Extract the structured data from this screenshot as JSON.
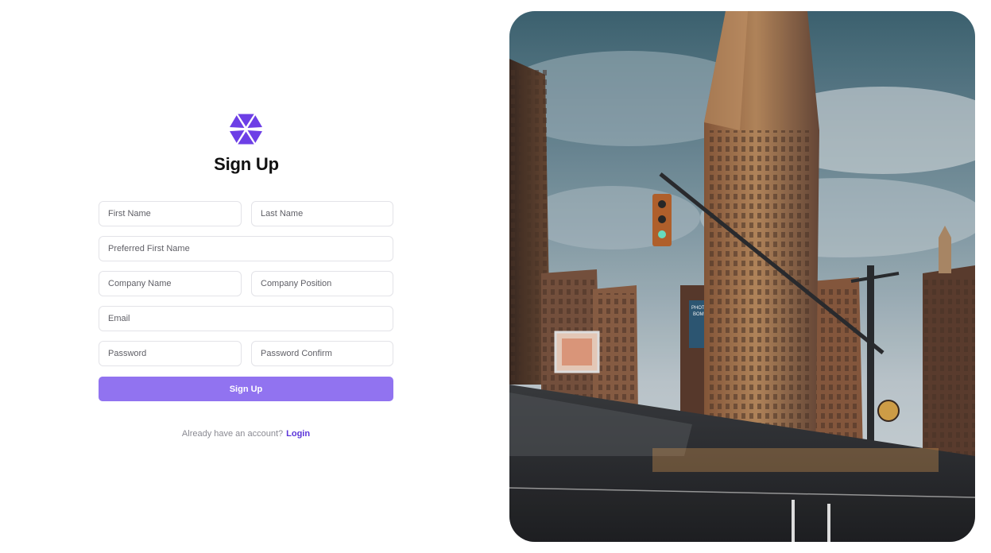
{
  "brand": {
    "logo_icon": "aperture-logo-icon",
    "accent_color": "#6d3fe6"
  },
  "form": {
    "title": "Sign Up",
    "first_name_placeholder": "First Name",
    "last_name_placeholder": "Last Name",
    "preferred_first_name_placeholder": "Preferred First Name",
    "company_name_placeholder": "Company Name",
    "company_position_placeholder": "Company Position",
    "email_placeholder": "Email",
    "password_placeholder": "Password",
    "password_confirm_placeholder": "Password Confirm",
    "submit_label": "Sign Up",
    "submit_color": "#9173f0"
  },
  "footer": {
    "prompt": "Already have an account?",
    "login_label": "Login",
    "login_color": "#5b34d9"
  },
  "hero_image": {
    "billboard_text_1": "PHOTO",
    "billboard_text_2": "BOMB"
  }
}
